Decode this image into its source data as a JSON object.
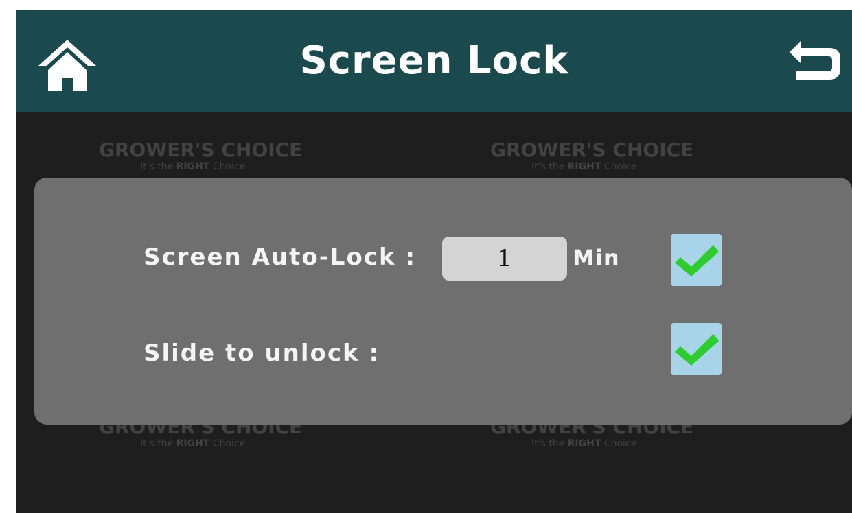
{
  "header": {
    "title": "Screen Lock",
    "home_icon": "home-icon",
    "back_icon": "back-arrow-icon"
  },
  "settings": {
    "auto_lock": {
      "label": "Screen Auto-Lock :",
      "value": "1",
      "unit": "Min",
      "checked": true
    },
    "slide_unlock": {
      "label": "Slide to unlock :",
      "checked": true
    }
  },
  "watermark": {
    "brand": "GROWER'S CHOICE",
    "tagline_prefix": "It's the ",
    "tagline_bold": "RIGHT",
    "tagline_suffix": " Choice"
  },
  "colors": {
    "header_bg": "#1b4a4e",
    "screen_bg": "#1e1e1e",
    "panel_bg": "#6f6f6f",
    "checkbox_bg": "#a8d4ea",
    "check_mark": "#2ecc2e"
  }
}
